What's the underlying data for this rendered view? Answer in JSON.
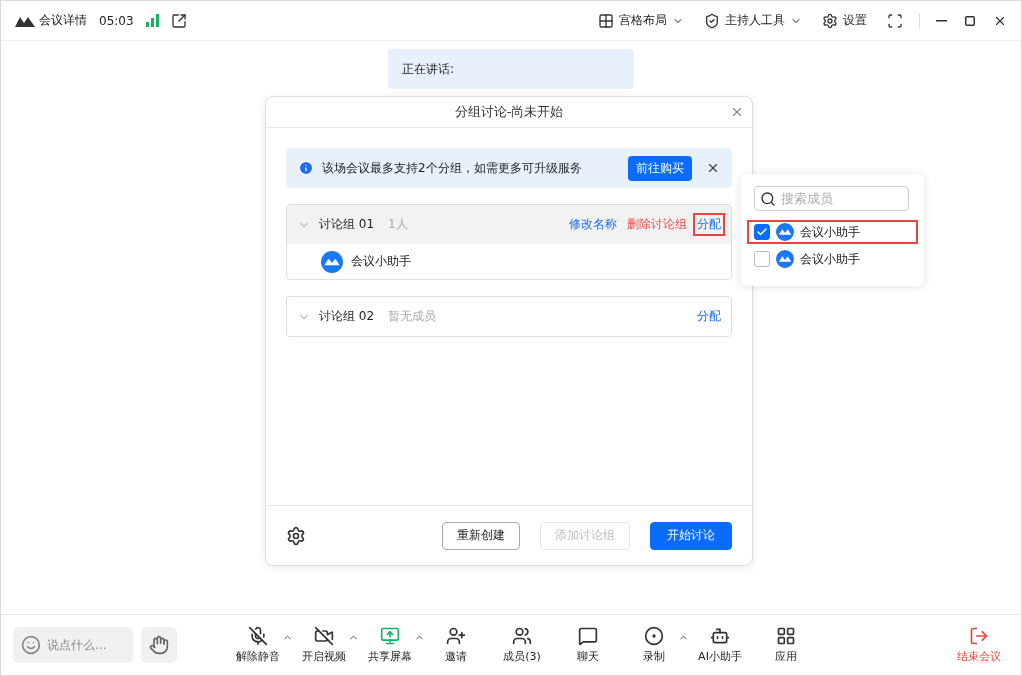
{
  "title_bar": {
    "title": "会议详情",
    "time": "05:03",
    "actions": [
      {
        "label": "宫格布局",
        "kind": "layout"
      },
      {
        "label": "主持人工具",
        "kind": "host"
      },
      {
        "label": "设置",
        "kind": "settings"
      }
    ]
  },
  "speaking": "正在讲话:",
  "dialog": {
    "title": "分组讨论-尚未开始",
    "notice": {
      "text": "该场会议最多支持2个分组，如需更多可升级服务",
      "button": "前往购买"
    },
    "groups": [
      {
        "name": "讨论组 01",
        "count": "1人",
        "actions": [
          {
            "label": "修改名称",
            "kind": "rename",
            "highlighted": false
          },
          {
            "label": "删除讨论组",
            "kind": "delete",
            "highlighted": false
          },
          {
            "label": "分配",
            "kind": "assign",
            "highlighted": true
          }
        ],
        "members": [
          "会议小助手"
        ]
      },
      {
        "name": "讨论组 02",
        "count": "暂无成员",
        "actions": [
          {
            "label": "分配",
            "kind": "assign",
            "highlighted": false
          }
        ]
      }
    ],
    "buttons": [
      {
        "label": "重新创建",
        "kind": "secondary",
        "disabled": false
      },
      {
        "label": "添加讨论组",
        "kind": "secondary",
        "disabled": true
      },
      {
        "label": "开始讨论",
        "kind": "primary",
        "disabled": false
      }
    ]
  },
  "member_picker": {
    "placeholder": "搜索成员",
    "members": [
      {
        "name": "会议小助手",
        "checked": true,
        "highlighted": true
      },
      {
        "name": "会议小助手",
        "checked": false,
        "highlighted": false
      }
    ]
  },
  "chat_input": {
    "placeholder": "说点什么..."
  },
  "toolbar": [
    {
      "label": "解除静音",
      "kind": "mic",
      "menu": true
    },
    {
      "label": "开启视频",
      "kind": "video",
      "menu": true
    },
    {
      "label": "共享屏幕",
      "kind": "share",
      "menu": true
    },
    {
      "label": "邀请",
      "kind": "invite",
      "menu": false
    },
    {
      "label": "成员(3)",
      "kind": "members",
      "menu": false
    },
    {
      "label": "聊天",
      "kind": "chat",
      "menu": false
    },
    {
      "label": "录制",
      "kind": "record",
      "menu": true
    },
    {
      "label": "AI小助手",
      "kind": "ai",
      "menu": false
    },
    {
      "label": "应用",
      "kind": "apps",
      "menu": false
    }
  ],
  "end_button": "结束会议"
}
